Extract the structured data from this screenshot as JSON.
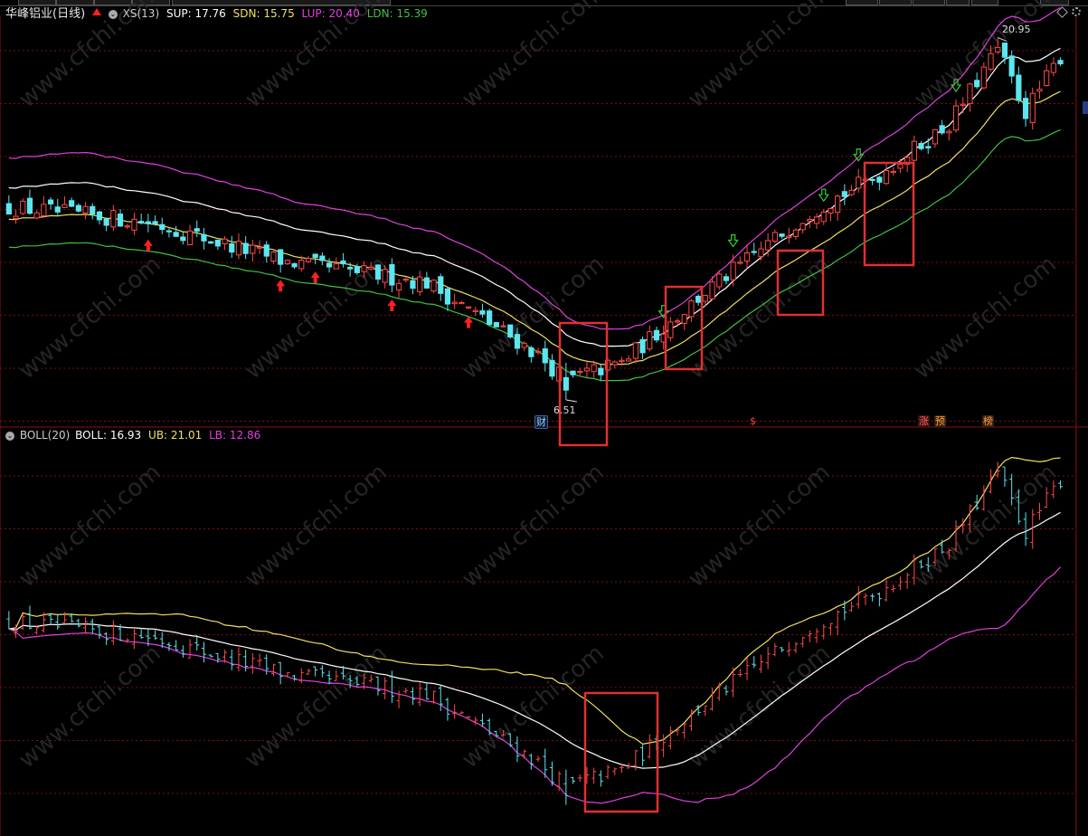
{
  "main": {
    "title": "华峰铝业",
    "period": "(日线)",
    "indicator": "XS(13)",
    "sup_label": "SUP: 17.76",
    "sdn_label": "SDN: 15.75",
    "lup_label": "LUP: 20.40",
    "ldn_label": "LDN: 15.39",
    "high_marker": "20.95",
    "low_marker": "6.51",
    "badges": [
      "财",
      "$",
      "涨",
      "预",
      "榜"
    ]
  },
  "sub": {
    "indicator": "BOLL(20)",
    "boll_label": "BOLL: 16.93",
    "ub_label": "UB: 21.01",
    "lb_label": "LB: 12.86"
  },
  "colors": {
    "up": "#ff4a4a",
    "down": "#5ce6f0",
    "sup": "#ffffff",
    "sdn": "#f0e060",
    "lup": "#e040e0",
    "ldn": "#40c040",
    "boll_mid": "#ffffff",
    "boll_ub": "#f0e060",
    "boll_lb": "#e040e0",
    "grid": "#7a1010",
    "highlight_box": "#e03030",
    "buy_arrow": "#ff2020",
    "sell_arrow": "#30d030",
    "watermark": "#2a2a2a"
  },
  "watermark_text": "www.cfchi.com"
}
